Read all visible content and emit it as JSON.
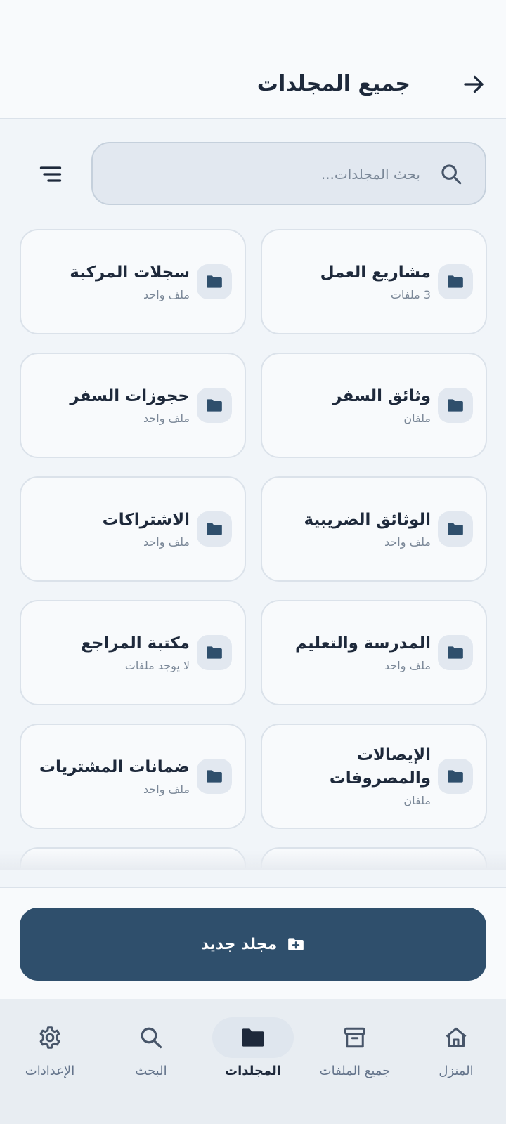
{
  "header": {
    "title": "جميع المجلدات",
    "back_icon": "arrow-right-icon"
  },
  "search": {
    "placeholder": "بحث المجلدات...",
    "value": "",
    "icon": "search-icon",
    "sort_icon": "filter-lines-icon"
  },
  "folders": [
    {
      "name": "مشاريع العمل",
      "count": "3 ملفات"
    },
    {
      "name": "سجلات المركبة",
      "count": "ملف واحد"
    },
    {
      "name": "وثائق السفر",
      "count": "ملفان"
    },
    {
      "name": "حجوزات السفر",
      "count": "ملف واحد"
    },
    {
      "name": "الوثائق الضريبية",
      "count": "ملف واحد"
    },
    {
      "name": "الاشتراكات",
      "count": "ملف واحد"
    },
    {
      "name": "المدرسة والتعليم",
      "count": "ملف واحد"
    },
    {
      "name": "مكتبة المراجع",
      "count": "لا يوجد ملفات"
    },
    {
      "name": "الإيصالات والمصروفات",
      "count": "ملفان"
    },
    {
      "name": "ضمانات المشتريات",
      "count": "ملف واحد"
    }
  ],
  "actions": {
    "new_folder_label": "مجلد جديد",
    "new_folder_icon": "folder-plus-icon"
  },
  "nav": {
    "home": "المنزل",
    "all_files": "جميع الملفات",
    "folders": "المجلدات",
    "search": "البحث",
    "settings": "الإعدادات",
    "active": "folders"
  },
  "colors": {
    "primary": "#2f4f6c",
    "background": "#f1f5f9",
    "surface": "#f8fafc",
    "text": "#1e293b",
    "muted": "#7a8797"
  }
}
